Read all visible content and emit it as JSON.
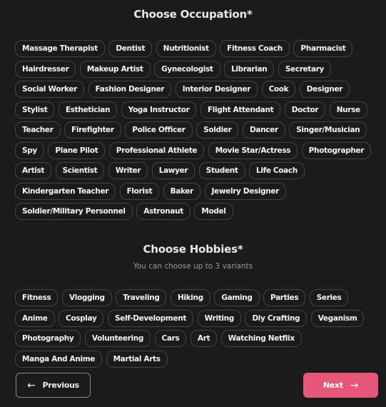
{
  "occupation": {
    "title": "Choose Occupation*",
    "options": [
      "Massage Therapist",
      "Dentist",
      "Nutritionist",
      "Fitness Coach",
      "Pharmacist",
      "Hairdresser",
      "Makeup Artist",
      "Gynecologist",
      "Librarian",
      "Secretary",
      "Social Worker",
      "Fashion Designer",
      "Interior Designer",
      "Cook",
      "Designer",
      "Stylist",
      "Esthetician",
      "Yoga Instructor",
      "Flight Attendant",
      "Doctor",
      "Nurse",
      "Teacher",
      "Firefighter",
      "Police Officer",
      "Soldier",
      "Dancer",
      "Singer/Musician",
      "Spy",
      "Plane Pilot",
      "Professional Athlete",
      "Movie Star/Actress",
      "Photographer",
      "Artist",
      "Scientist",
      "Writer",
      "Lawyer",
      "Student",
      "Life Coach",
      "Kindergarten Teacher",
      "Florist",
      "Baker",
      "Jewelry Designer",
      "Soldier/Military Personnel",
      "Astronaut",
      "Model"
    ]
  },
  "hobbies": {
    "title": "Choose Hobbies*",
    "subtitle": "You can choose up to 3 variants",
    "options": [
      "Fitness",
      "Vlogging",
      "Traveling",
      "Hiking",
      "Gaming",
      "Parties",
      "Series",
      "Anime",
      "Cosplay",
      "Self-Development",
      "Writing",
      "Diy Crafting",
      "Veganism",
      "Photography",
      "Volunteering",
      "Cars",
      "Art",
      "Watching Netflix",
      "Manga And Anime",
      "Martial Arts"
    ]
  },
  "nav": {
    "previous_label": "Previous",
    "next_label": "Next",
    "previous_icon": "arrow-left-icon",
    "next_icon": "arrow-right-icon",
    "accent_color": "#e5567a"
  }
}
